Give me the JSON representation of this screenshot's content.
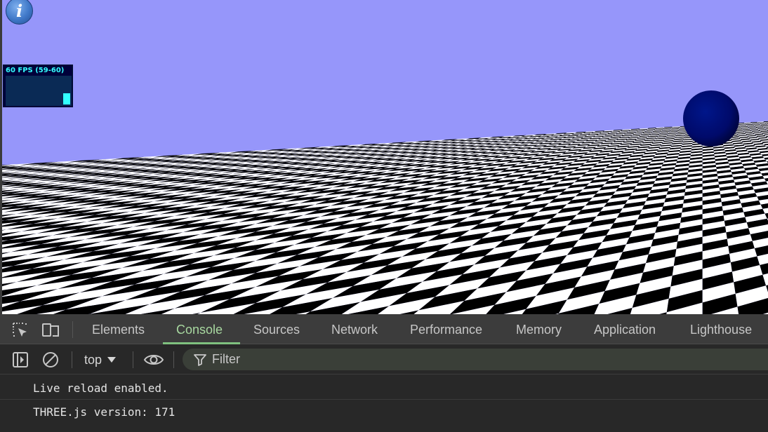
{
  "viewport": {
    "sky_color": "#9696fa",
    "info_button": {
      "glyph": "i",
      "icon": "info-icon"
    },
    "stats": {
      "label": "60 FPS (59-60)",
      "fps_fraction": 0.4
    },
    "floor": {
      "colors": [
        "#000000",
        "#ffffff"
      ]
    },
    "sphere": {
      "color": "#00006e"
    }
  },
  "devtools": {
    "toolbar_icons": [
      "inspect-element-icon",
      "device-toggle-icon"
    ],
    "tabs": [
      {
        "label": "Elements",
        "active": false
      },
      {
        "label": "Console",
        "active": true
      },
      {
        "label": "Sources",
        "active": false
      },
      {
        "label": "Network",
        "active": false
      },
      {
        "label": "Performance",
        "active": false
      },
      {
        "label": "Memory",
        "active": false
      },
      {
        "label": "Application",
        "active": false
      },
      {
        "label": "Lighthouse",
        "active": false
      }
    ],
    "console_toolbar": {
      "context": "top",
      "filter_label": "Filter"
    },
    "messages": [
      "Live reload enabled.",
      "THREE.js version: 171"
    ],
    "accent": "#7fc17f"
  }
}
